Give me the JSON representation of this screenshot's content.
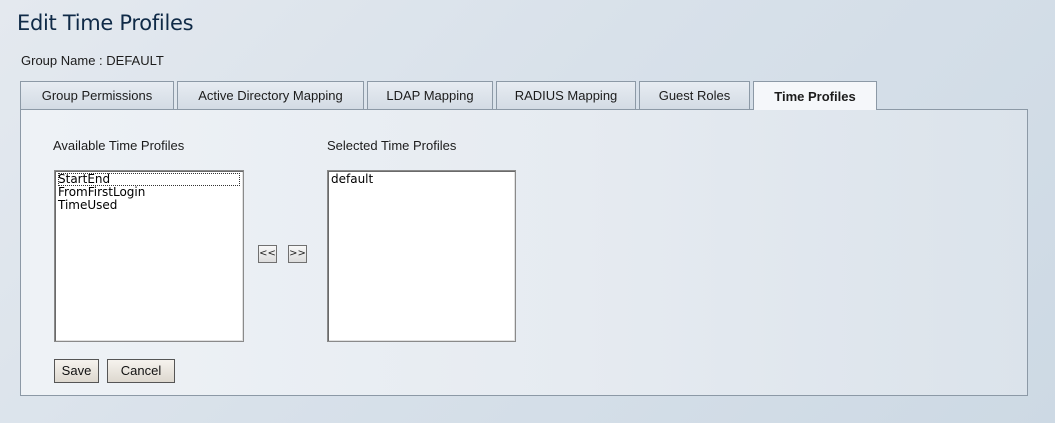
{
  "header": {
    "title": "Edit Time Profiles",
    "group_name": "Group Name : DEFAULT"
  },
  "tabs": [
    {
      "label": "Group Permissions",
      "active": false
    },
    {
      "label": "Active Directory Mapping",
      "active": false
    },
    {
      "label": "LDAP Mapping",
      "active": false
    },
    {
      "label": "RADIUS Mapping",
      "active": false
    },
    {
      "label": "Guest Roles",
      "active": false
    },
    {
      "label": "Time Profiles",
      "active": true
    }
  ],
  "available": {
    "label": "Available Time Profiles",
    "options": [
      "StartEnd",
      "FromFirstLogin",
      "TimeUsed"
    ]
  },
  "selected": {
    "label": "Selected Time Profiles",
    "options": [
      "default"
    ]
  },
  "transfer": {
    "remove_label": "<<",
    "add_label": ">>"
  },
  "actions": {
    "save_label": "Save",
    "cancel_label": "Cancel"
  }
}
